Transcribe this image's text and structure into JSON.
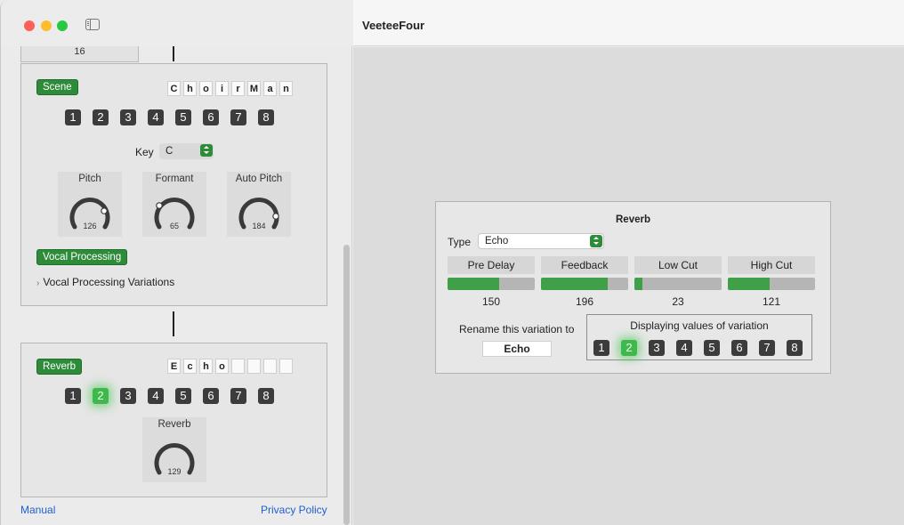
{
  "window": {
    "title": "VeeteeFour"
  },
  "sidebar": {
    "top_partial_value": "16",
    "scene_panel": {
      "pill_label": "Scene",
      "name_chars": [
        "C",
        "h",
        "o",
        "i",
        "r",
        "M",
        "a",
        "n"
      ],
      "variation_buttons": [
        "1",
        "2",
        "3",
        "4",
        "5",
        "6",
        "7",
        "8"
      ],
      "key_label": "Key",
      "key_value": "C",
      "knobs": [
        {
          "title": "Pitch",
          "value": "126"
        },
        {
          "title": "Formant",
          "value": "65"
        },
        {
          "title": "Auto Pitch",
          "value": "184"
        }
      ],
      "vocal_processing_label": "Vocal Processing",
      "disclosure_label": "Vocal Processing Variations"
    },
    "reverb_panel": {
      "pill_label": "Reverb",
      "name_chars": [
        "E",
        "c",
        "h",
        "o",
        "",
        "",
        "",
        ""
      ],
      "variation_buttons": [
        "1",
        "2",
        "3",
        "4",
        "5",
        "6",
        "7",
        "8"
      ],
      "active_variation": "2",
      "knob": {
        "title": "Reverb",
        "value": "129"
      }
    },
    "footer": {
      "manual_label": "Manual",
      "privacy_label": "Privacy Policy"
    }
  },
  "reverb_card": {
    "title": "Reverb",
    "type_label": "Type",
    "type_value": "Echo",
    "params": [
      {
        "label": "Pre Delay",
        "value": "150",
        "fraction": 0.59
      },
      {
        "label": "Feedback",
        "value": "196",
        "fraction": 0.77
      },
      {
        "label": "Low Cut",
        "value": "23",
        "fraction": 0.09
      },
      {
        "label": "High Cut",
        "value": "121",
        "fraction": 0.48
      }
    ],
    "rename_label": "Rename this variation to",
    "rename_value": "Echo",
    "displaying_label": "Displaying values of variation",
    "variation_buttons": [
      "1",
      "2",
      "3",
      "4",
      "5",
      "6",
      "7",
      "8"
    ],
    "active_variation": "2"
  },
  "colors": {
    "accent_green": "#2d8b3a",
    "active_green": "#3fb84d",
    "link_blue": "#1e5fd0"
  }
}
